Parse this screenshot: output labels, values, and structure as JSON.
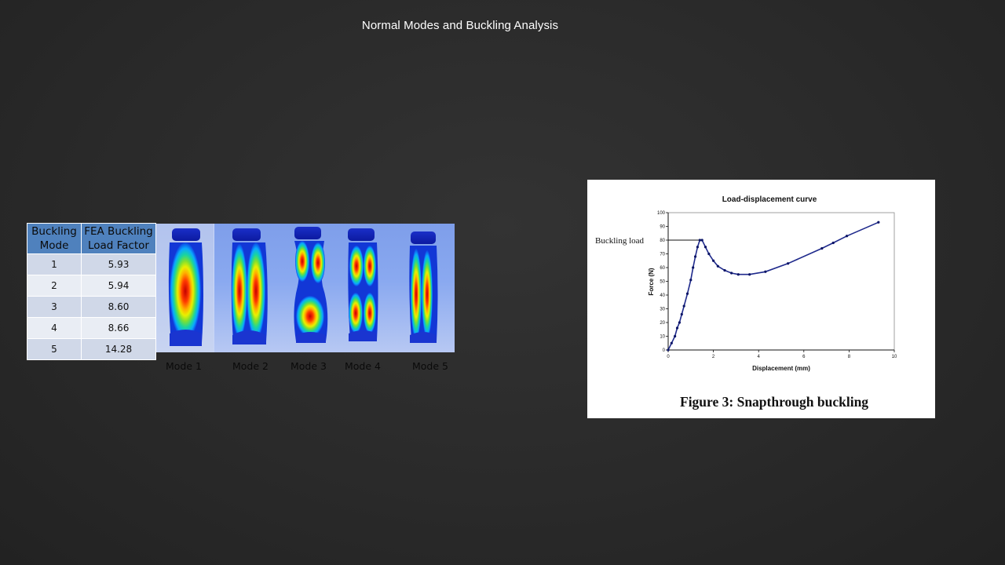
{
  "slide": {
    "title": "Normal Modes and Buckling Analysis"
  },
  "table": {
    "headers": [
      "Buckling Mode",
      "FEA Buckling Load Factor"
    ],
    "header_lines": [
      [
        "Buckling",
        "Mode"
      ],
      [
        "FEA Buckling",
        "Load Factor"
      ]
    ],
    "rows": [
      {
        "mode": "1",
        "factor": "5.93"
      },
      {
        "mode": "2",
        "factor": "5.94"
      },
      {
        "mode": "3",
        "factor": "8.60"
      },
      {
        "mode": "4",
        "factor": "8.66"
      },
      {
        "mode": "5",
        "factor": "14.28"
      }
    ],
    "header_color": "#4f81bd",
    "row_colors": [
      "#d0d8e8",
      "#e9edf4"
    ]
  },
  "mode_images": {
    "labels": [
      "Mode 1",
      "Mode 2",
      "Mode 3",
      "Mode 4",
      "Mode 5"
    ]
  },
  "chart": {
    "buckling_label": "Buckling load",
    "caption": "Figure 3: Snapthrough buckling"
  },
  "chart_data": {
    "type": "line",
    "title": "Load-displacement curve",
    "xlabel": "Displacement (mm)",
    "ylabel": "Force (N)",
    "xlim": [
      0,
      10
    ],
    "ylim": [
      0,
      100
    ],
    "xticks": [
      0,
      2,
      4,
      6,
      8,
      10
    ],
    "yticks": [
      0,
      10,
      20,
      30,
      40,
      50,
      60,
      70,
      80,
      90,
      100
    ],
    "grid": false,
    "annotation": {
      "text": "Buckling load",
      "y": 80
    },
    "series": [
      {
        "color": "#1f2a8c",
        "x": [
          0,
          0.15,
          0.3,
          0.4,
          0.5,
          0.6,
          0.7,
          0.85,
          1.0,
          1.1,
          1.2,
          1.3,
          1.4,
          1.5,
          1.65,
          1.8,
          2.0,
          2.2,
          2.5,
          2.8,
          3.1,
          3.6,
          4.3,
          5.3,
          6.8,
          7.3,
          7.9,
          9.3
        ],
        "y": [
          0,
          5,
          10,
          16,
          20,
          26,
          32,
          41,
          51,
          60,
          68,
          75,
          80,
          80,
          75,
          70,
          65,
          61,
          58,
          56,
          55,
          55,
          57,
          63,
          74,
          78,
          83,
          93
        ]
      }
    ]
  }
}
